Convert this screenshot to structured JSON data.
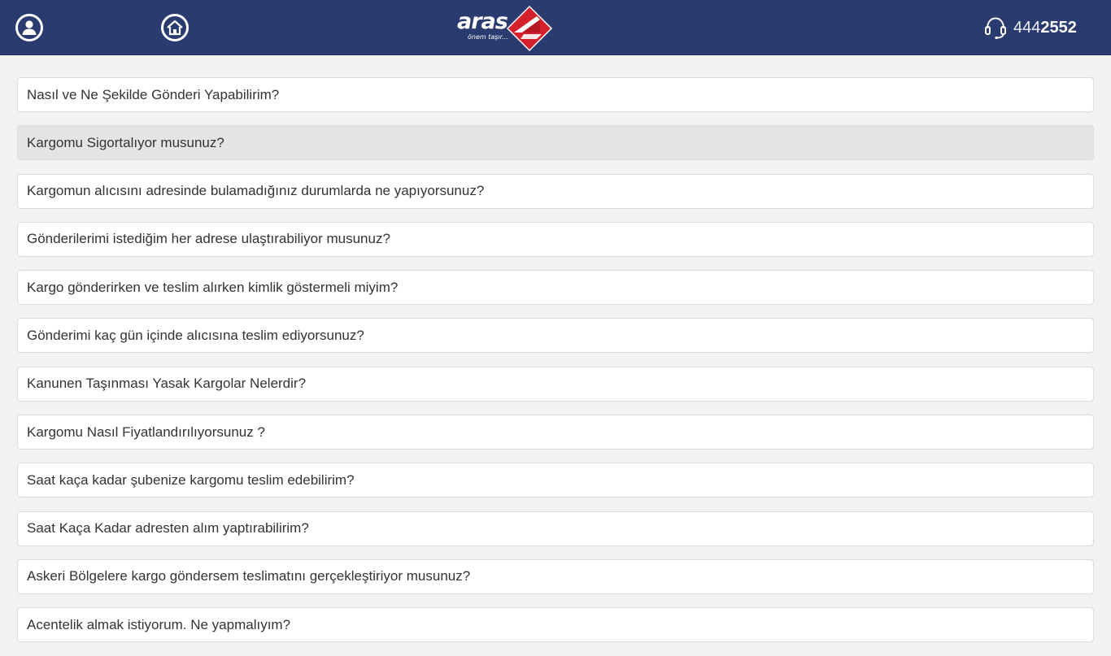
{
  "header": {
    "profile_icon": "user-icon",
    "home_icon": "home-icon",
    "logo": {
      "brand": "aras",
      "slogan": "önem taşır..."
    },
    "phone": {
      "icon": "headset-icon",
      "prefix": "444",
      "number": "2552"
    },
    "colors": {
      "background": "#2a3c6f",
      "logo_red": "#d4202c"
    }
  },
  "faq": {
    "items": [
      {
        "label": "Nasıl ve Ne Şekilde Gönderi Yapabilirim?"
      },
      {
        "label": "Kargomu Sigortalıyor musunuz?",
        "active": true
      },
      {
        "label": "Kargomun alıcısını adresinde bulamadığınız durumlarda ne yapıyorsunuz?"
      },
      {
        "label": "Gönderilerimi istediğim her adrese ulaştırabiliyor musunuz?"
      },
      {
        "label": "Kargo gönderirken ve teslim alırken kimlik göstermeli miyim?"
      },
      {
        "label": "Gönderimi kaç gün içinde alıcısına teslim ediyorsunuz?"
      },
      {
        "label": "Kanunen Taşınması Yasak Kargolar Nelerdir?"
      },
      {
        "label": "Kargomu Nasıl Fiyatlandırılıyorsunuz ?"
      },
      {
        "label": "Saat kaça kadar şubenize kargomu teslim edebilirim?"
      },
      {
        "label": "Saat Kaça Kadar adresten alım yaptırabilirim?"
      },
      {
        "label": "Askeri Bölgelere kargo göndersem teslimatını gerçekleştiriyor musunuz?"
      },
      {
        "label": "Acentelik almak istiyorum. Ne yapmalıyım?"
      }
    ]
  }
}
